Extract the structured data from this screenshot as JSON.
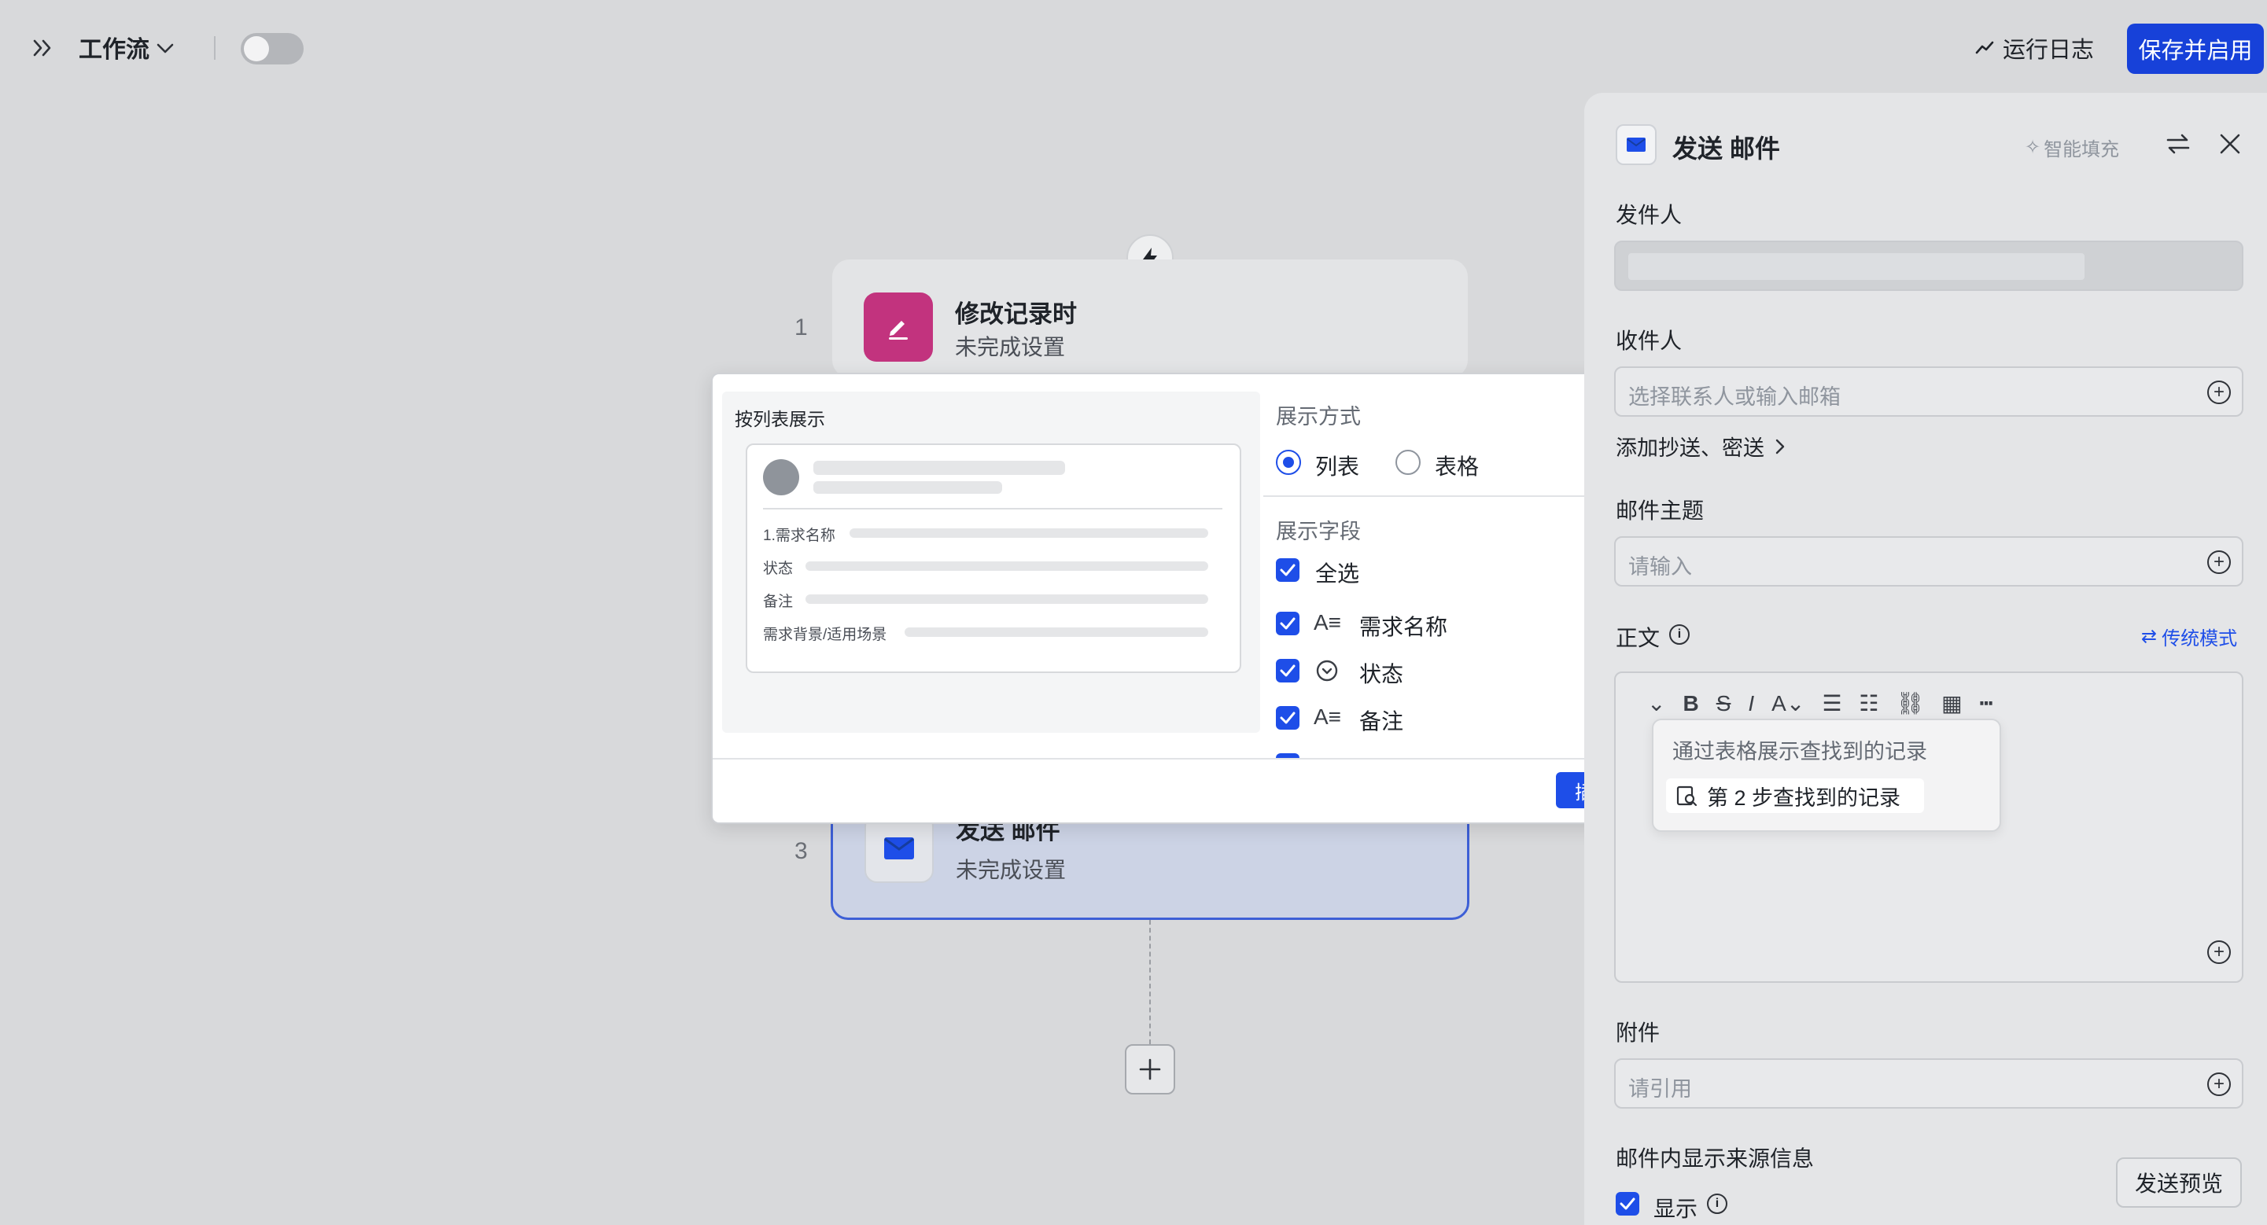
{
  "topbar": {
    "title": "工作流",
    "run_log": "运行日志",
    "save": "保存并启用"
  },
  "canvas": {
    "node1": {
      "num": "1",
      "title": "修改记录时",
      "sub": "未完成设置"
    },
    "node3": {
      "num": "3",
      "title": "发送  邮件",
      "sub": "未完成设置"
    }
  },
  "popup": {
    "preview_title": "按列表展示",
    "preview_rows": [
      "1.需求名称",
      "状态",
      "备注",
      "需求背景/适用场景"
    ],
    "display_mode_label": "展示方式",
    "mode_list": "列表",
    "mode_table": "表格",
    "fields_label": "展示字段",
    "select_all": "全选",
    "fields": [
      "需求名称",
      "状态",
      "备注"
    ],
    "insert": "插入"
  },
  "panel": {
    "title": "发送  邮件",
    "smart_fill": "智能填充",
    "sender_label": "发件人",
    "recipient_label": "收件人",
    "recipient_placeholder": "选择联系人或输入邮箱",
    "cc_link": "添加抄送、密送",
    "subject_label": "邮件主题",
    "subject_placeholder": "请输入",
    "body_label": "正文",
    "legacy_mode": "传统模式",
    "dropdown_title": "通过表格展示查找到的记录",
    "dropdown_item": "第 2 步查找到的记录",
    "attachment_label": "附件",
    "attachment_placeholder": "请引用",
    "source_label": "邮件内显示来源信息",
    "source_show": "显示",
    "send_preview": "发送预览"
  },
  "colors": {
    "accent": "#1e4ee8",
    "save_button": "#1741d9",
    "trigger_icon": "#c2337e"
  }
}
